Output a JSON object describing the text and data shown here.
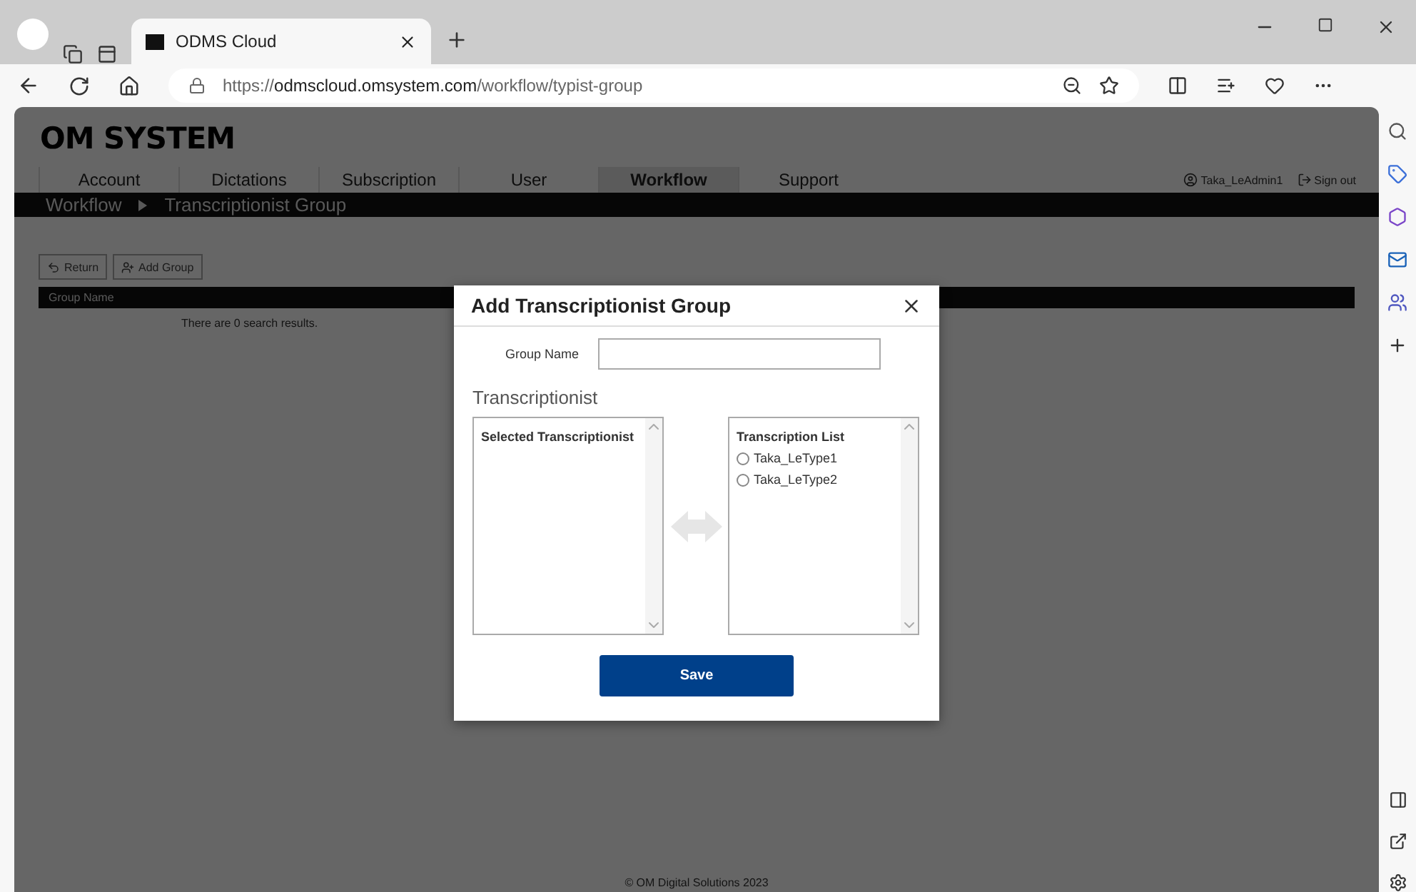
{
  "browser": {
    "tabs": [
      {
        "title": "ODMS Cloud",
        "selected": true
      }
    ],
    "url": "https://**odmscloud.omsystem.com**/workflow/typist-group"
  },
  "page": {
    "logo": "OM SYSTEM",
    "nav": [
      {
        "label": "Account",
        "selected": false
      },
      {
        "label": "Dictations",
        "selected": false
      },
      {
        "label": "Subscription",
        "selected": false
      },
      {
        "label": "User",
        "selected": false
      },
      {
        "label": "Workflow",
        "selected": true
      },
      {
        "label": "Support",
        "selected": false
      }
    ],
    "user": "Taka_LeAdmin1",
    "sign_out": "Sign out",
    "breadcrumb": [
      "Workflow",
      "Transcriptionist Group"
    ],
    "buttons": [
      {
        "kind": "return",
        "label": "Return"
      },
      {
        "kind": "add",
        "label": "Add Group"
      }
    ],
    "table": {
      "columns": [
        "Group Name"
      ],
      "empty_message": "There are 0 search results."
    },
    "footer": "© OM Digital Solutions 2023"
  },
  "dialog": {
    "title": "Add Transcriptionist Group",
    "group_name_label": "Group Name",
    "section": "Transcriptionist",
    "selected_list": {
      "header": "Selected Transcriptionist"
    },
    "available_list": {
      "header": "Transcription List",
      "items": [
        {
          "label": "Taka_LeType1",
          "selected": false
        },
        {
          "label": "Taka_LeType2",
          "selected": false
        }
      ]
    },
    "save": "Save"
  }
}
